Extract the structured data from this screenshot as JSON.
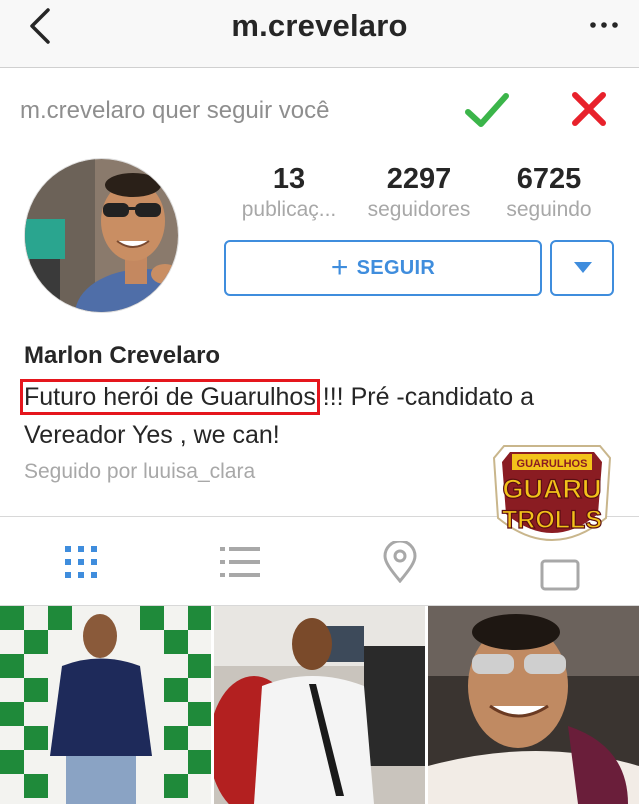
{
  "header": {
    "title": "m.crevelaro",
    "back_icon": "chevron-left-icon",
    "menu_icon": "more-dots-icon"
  },
  "request": {
    "text": "m.crevelaro quer seguir você",
    "accept_icon": "checkmark-icon",
    "reject_icon": "close-icon",
    "accept_color": "#3bb54a",
    "reject_color": "#e8212b"
  },
  "stats": [
    {
      "value": "13",
      "label": "publicaç..."
    },
    {
      "value": "2297",
      "label": "seguidores"
    },
    {
      "value": "6725",
      "label": "seguindo"
    }
  ],
  "actions": {
    "follow_plus": "+",
    "follow_label": "SEGUIR",
    "accent": "#3f8ddd"
  },
  "profile": {
    "name": "Marlon Crevelaro",
    "bio_highlight": "Futuro herói de Guarulhos",
    "bio_rest_1": " !!! Pré -candidato a",
    "bio_line2": "Vereador Yes , we can!",
    "followed_by": "Seguido por luuisa_clara"
  },
  "watermark": {
    "line1": "GUARULHOS",
    "line2": "GUARU",
    "line3": "TROLLS"
  },
  "tabs": [
    "grid-icon",
    "list-icon",
    "location-pin-icon",
    "tagged-icon"
  ]
}
